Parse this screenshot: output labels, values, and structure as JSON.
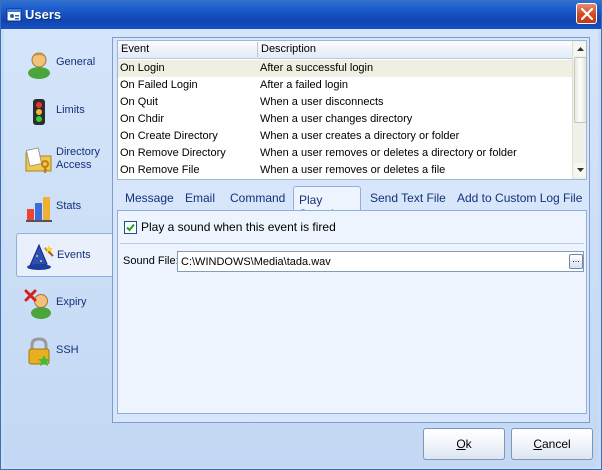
{
  "window": {
    "title": "Users",
    "title_icon": "users-window-icon"
  },
  "sidebar": {
    "items": [
      {
        "label": "General",
        "icon": "user-avatar-icon"
      },
      {
        "label": "Limits",
        "icon": "traffic-light-icon"
      },
      {
        "label": "Directory Access",
        "icon": "folder-key-icon"
      },
      {
        "label": "Stats",
        "icon": "stats-icon"
      },
      {
        "label": "Events",
        "icon": "wizard-hat-icon",
        "active": true
      },
      {
        "label": "Expiry",
        "icon": "user-expired-icon"
      },
      {
        "label": "SSH",
        "icon": "lock-icon"
      }
    ]
  },
  "events": {
    "columns": [
      "Event",
      "Description"
    ],
    "rows": [
      {
        "event": "On Login",
        "description": "After a successful login",
        "selected": true
      },
      {
        "event": "On Failed Login",
        "description": "After a failed login"
      },
      {
        "event": "On Quit",
        "description": "When a user disconnects"
      },
      {
        "event": "On Chdir",
        "description": "When a user changes directory"
      },
      {
        "event": "On Create Directory",
        "description": "When a user creates a directory or folder"
      },
      {
        "event": "On Remove Directory",
        "description": "When a user removes or deletes a directory or folder"
      },
      {
        "event": "On Remove File",
        "description": "When a user removes or deletes a file"
      }
    ]
  },
  "tabs": {
    "items": [
      "Message",
      "Email",
      "Command",
      "Play Sound",
      "Send Text File",
      "Add to Custom Log File"
    ],
    "active": "Play Sound"
  },
  "play_sound": {
    "checkbox_label": "Play a sound when this event is fired",
    "checked": true,
    "sound_file_label": "Sound File:",
    "sound_file_value": "C:\\WINDOWS\\Media\\tada.wav",
    "browse_label": "..."
  },
  "buttons": {
    "ok_access_key": "O",
    "ok_rest": "k",
    "cancel_access_key": "C",
    "cancel_rest": "ancel"
  },
  "colors": {
    "titlebar": "#1a55c4",
    "selected_row": "#efefe2",
    "link_text": "#15307a"
  }
}
